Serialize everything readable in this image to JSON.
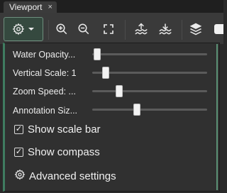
{
  "tab": {
    "label": "Viewport",
    "close_glyph": "×"
  },
  "toolbar": {
    "buttons": [
      {
        "icon": "gear-icon",
        "label": "Settings"
      },
      {
        "icon": "zoom-in-icon"
      },
      {
        "icon": "zoom-out-icon"
      },
      {
        "icon": "fit-to-view-icon"
      },
      {
        "icon": "raise-water-icon"
      },
      {
        "icon": "lower-water-icon"
      },
      {
        "icon": "layers-icon"
      }
    ]
  },
  "panel": {
    "sliders": [
      {
        "label": "Water Opacity...",
        "value": 0.02
      },
      {
        "label": "Vertical Scale: 1",
        "value": 0.1
      },
      {
        "label": "Zoom Speed: ...",
        "value": 0.22
      },
      {
        "label": "Annotation Siz...",
        "value": 0.38
      }
    ],
    "checkboxes": [
      {
        "label": "Show scale bar",
        "checked": true
      },
      {
        "label": "Show compass",
        "checked": true
      }
    ],
    "advanced": {
      "label": "Advanced settings",
      "icon": "gear-icon"
    }
  },
  "colors": {
    "accent": "#3f7c60",
    "panel_bg": "#303030",
    "toolbar_bg": "#3a3a3a"
  }
}
